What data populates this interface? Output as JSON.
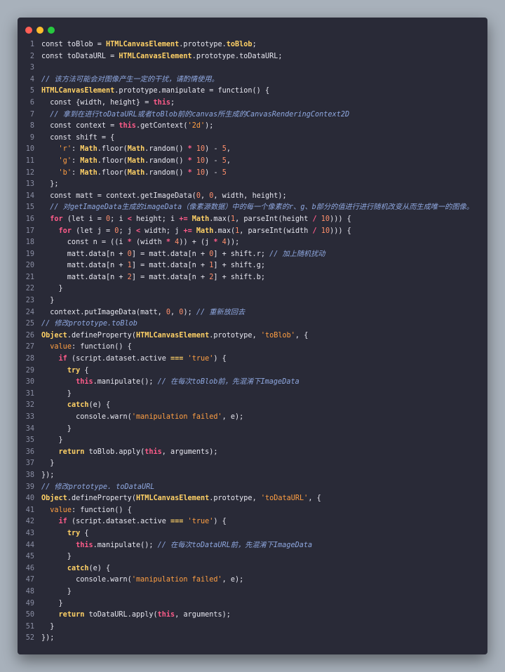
{
  "window": {
    "controls": [
      "close-dot",
      "minimize-dot",
      "maximize-dot"
    ]
  },
  "code_lines": [
    [
      {
        "t": "const toBlob = ",
        "c": "pl"
      },
      {
        "t": "HTMLCanvasElement",
        "c": "g"
      },
      {
        "t": ".prototype.",
        "c": "pl"
      },
      {
        "t": "toBlob",
        "c": "g"
      },
      {
        "t": ";",
        "c": "pl"
      }
    ],
    [
      {
        "t": "const toDataURL = ",
        "c": "pl"
      },
      {
        "t": "HTMLCanvasElement",
        "c": "g"
      },
      {
        "t": ".prototype.toDataURL;",
        "c": "pl"
      }
    ],
    [],
    [
      {
        "t": "// 该方法可能会对图像产生一定的干扰，请酌情使用。",
        "c": "c"
      }
    ],
    [
      {
        "t": "HTMLCanvasElement",
        "c": "g"
      },
      {
        "t": ".prototype.manipulate = function() {",
        "c": "pl"
      }
    ],
    [
      {
        "t": "  const {width, height} = ",
        "c": "pl"
      },
      {
        "t": "this",
        "c": "k"
      },
      {
        "t": ";",
        "c": "pl"
      }
    ],
    [
      {
        "t": "  // 拿到在进行toDataURL或者toBlob前的canvas所生成的CanvasRenderingContext2D",
        "c": "c"
      }
    ],
    [
      {
        "t": "  const context = ",
        "c": "pl"
      },
      {
        "t": "this",
        "c": "k"
      },
      {
        "t": ".getContext(",
        "c": "pl"
      },
      {
        "t": "'2d'",
        "c": "s"
      },
      {
        "t": ");",
        "c": "pl"
      }
    ],
    [
      {
        "t": "  const shift = {",
        "c": "pl"
      }
    ],
    [
      {
        "t": "    ",
        "c": "pl"
      },
      {
        "t": "'r'",
        "c": "s"
      },
      {
        "t": ": ",
        "c": "pl"
      },
      {
        "t": "Math",
        "c": "g"
      },
      {
        "t": ".floor(",
        "c": "pl"
      },
      {
        "t": "Math",
        "c": "g"
      },
      {
        "t": ".random() ",
        "c": "pl"
      },
      {
        "t": "*",
        "c": "k"
      },
      {
        "t": " ",
        "c": "pl"
      },
      {
        "t": "10",
        "c": "n"
      },
      {
        "t": ") - ",
        "c": "pl"
      },
      {
        "t": "5",
        "c": "n"
      },
      {
        "t": ",",
        "c": "pl"
      }
    ],
    [
      {
        "t": "    ",
        "c": "pl"
      },
      {
        "t": "'g'",
        "c": "s"
      },
      {
        "t": ": ",
        "c": "pl"
      },
      {
        "t": "Math",
        "c": "g"
      },
      {
        "t": ".floor(",
        "c": "pl"
      },
      {
        "t": "Math",
        "c": "g"
      },
      {
        "t": ".random() ",
        "c": "pl"
      },
      {
        "t": "*",
        "c": "k"
      },
      {
        "t": " ",
        "c": "pl"
      },
      {
        "t": "10",
        "c": "n"
      },
      {
        "t": ") - ",
        "c": "pl"
      },
      {
        "t": "5",
        "c": "n"
      },
      {
        "t": ",",
        "c": "pl"
      }
    ],
    [
      {
        "t": "    ",
        "c": "pl"
      },
      {
        "t": "'b'",
        "c": "s"
      },
      {
        "t": ": ",
        "c": "pl"
      },
      {
        "t": "Math",
        "c": "g"
      },
      {
        "t": ".floor(",
        "c": "pl"
      },
      {
        "t": "Math",
        "c": "g"
      },
      {
        "t": ".random() ",
        "c": "pl"
      },
      {
        "t": "*",
        "c": "k"
      },
      {
        "t": " ",
        "c": "pl"
      },
      {
        "t": "10",
        "c": "n"
      },
      {
        "t": ") - ",
        "c": "pl"
      },
      {
        "t": "5",
        "c": "n"
      }
    ],
    [
      {
        "t": "  };",
        "c": "pl"
      }
    ],
    [
      {
        "t": "  const matt = context.getImageData(",
        "c": "pl"
      },
      {
        "t": "0",
        "c": "n"
      },
      {
        "t": ", ",
        "c": "pl"
      },
      {
        "t": "0",
        "c": "n"
      },
      {
        "t": ", width, height);",
        "c": "pl"
      }
    ],
    [
      {
        "t": "  // 对getImageData生成的imageData（像素源数据）中的每一个像素的r、g、b部分的值进行进行随机改变从而生成唯一的图像。",
        "c": "c"
      }
    ],
    [
      {
        "t": "  ",
        "c": "pl"
      },
      {
        "t": "for",
        "c": "k"
      },
      {
        "t": " (let i = ",
        "c": "pl"
      },
      {
        "t": "0",
        "c": "n"
      },
      {
        "t": "; i ",
        "c": "pl"
      },
      {
        "t": "<",
        "c": "k"
      },
      {
        "t": " height; i ",
        "c": "pl"
      },
      {
        "t": "+=",
        "c": "k"
      },
      {
        "t": " ",
        "c": "pl"
      },
      {
        "t": "Math",
        "c": "g"
      },
      {
        "t": ".max(",
        "c": "pl"
      },
      {
        "t": "1",
        "c": "n"
      },
      {
        "t": ", parseInt(height ",
        "c": "pl"
      },
      {
        "t": "/",
        "c": "k"
      },
      {
        "t": " ",
        "c": "pl"
      },
      {
        "t": "10",
        "c": "n"
      },
      {
        "t": "))) {",
        "c": "pl"
      }
    ],
    [
      {
        "t": "    ",
        "c": "pl"
      },
      {
        "t": "for",
        "c": "k"
      },
      {
        "t": " (let j = ",
        "c": "pl"
      },
      {
        "t": "0",
        "c": "n"
      },
      {
        "t": "; j ",
        "c": "pl"
      },
      {
        "t": "<",
        "c": "k"
      },
      {
        "t": " width; j ",
        "c": "pl"
      },
      {
        "t": "+=",
        "c": "k"
      },
      {
        "t": " ",
        "c": "pl"
      },
      {
        "t": "Math",
        "c": "g"
      },
      {
        "t": ".max(",
        "c": "pl"
      },
      {
        "t": "1",
        "c": "n"
      },
      {
        "t": ", parseInt(width ",
        "c": "pl"
      },
      {
        "t": "/",
        "c": "k"
      },
      {
        "t": " ",
        "c": "pl"
      },
      {
        "t": "10",
        "c": "n"
      },
      {
        "t": "))) {",
        "c": "pl"
      }
    ],
    [
      {
        "t": "      const n = ((i ",
        "c": "pl"
      },
      {
        "t": "*",
        "c": "k"
      },
      {
        "t": " (width ",
        "c": "pl"
      },
      {
        "t": "*",
        "c": "k"
      },
      {
        "t": " ",
        "c": "pl"
      },
      {
        "t": "4",
        "c": "n"
      },
      {
        "t": ")) + (j ",
        "c": "pl"
      },
      {
        "t": "*",
        "c": "k"
      },
      {
        "t": " ",
        "c": "pl"
      },
      {
        "t": "4",
        "c": "n"
      },
      {
        "t": "));",
        "c": "pl"
      }
    ],
    [
      {
        "t": "      matt.data[n + ",
        "c": "pl"
      },
      {
        "t": "0",
        "c": "n"
      },
      {
        "t": "] = matt.data[n + ",
        "c": "pl"
      },
      {
        "t": "0",
        "c": "n"
      },
      {
        "t": "] + shift.r; ",
        "c": "pl"
      },
      {
        "t": "// 加上随机扰动",
        "c": "c"
      }
    ],
    [
      {
        "t": "      matt.data[n + ",
        "c": "pl"
      },
      {
        "t": "1",
        "c": "n"
      },
      {
        "t": "] = matt.data[n + ",
        "c": "pl"
      },
      {
        "t": "1",
        "c": "n"
      },
      {
        "t": "] + shift.g;",
        "c": "pl"
      }
    ],
    [
      {
        "t": "      matt.data[n + ",
        "c": "pl"
      },
      {
        "t": "2",
        "c": "n"
      },
      {
        "t": "] = matt.data[n + ",
        "c": "pl"
      },
      {
        "t": "2",
        "c": "n"
      },
      {
        "t": "] + shift.b;",
        "c": "pl"
      }
    ],
    [
      {
        "t": "    }",
        "c": "pl"
      }
    ],
    [
      {
        "t": "  }",
        "c": "pl"
      }
    ],
    [
      {
        "t": "  context.putImageData(matt, ",
        "c": "pl"
      },
      {
        "t": "0",
        "c": "n"
      },
      {
        "t": ", ",
        "c": "pl"
      },
      {
        "t": "0",
        "c": "n"
      },
      {
        "t": "); ",
        "c": "pl"
      },
      {
        "t": "// 重新放回去",
        "c": "c"
      }
    ],
    [
      {
        "t": "// 修改prototype.toBlob",
        "c": "c"
      }
    ],
    [
      {
        "t": "Object",
        "c": "g"
      },
      {
        "t": ".defineProperty(",
        "c": "pl"
      },
      {
        "t": "HTMLCanvasElement",
        "c": "g"
      },
      {
        "t": ".prototype, ",
        "c": "pl"
      },
      {
        "t": "'toBlob'",
        "c": "s"
      },
      {
        "t": ", {",
        "c": "pl"
      }
    ],
    [
      {
        "t": "  ",
        "c": "pl"
      },
      {
        "t": "value",
        "c": "s"
      },
      {
        "t": ": function() {",
        "c": "pl"
      }
    ],
    [
      {
        "t": "    ",
        "c": "pl"
      },
      {
        "t": "if",
        "c": "k"
      },
      {
        "t": " (script.dataset.active ",
        "c": "pl"
      },
      {
        "t": "===",
        "c": "g"
      },
      {
        "t": " ",
        "c": "pl"
      },
      {
        "t": "'true'",
        "c": "s"
      },
      {
        "t": ") {",
        "c": "pl"
      }
    ],
    [
      {
        "t": "      ",
        "c": "pl"
      },
      {
        "t": "try",
        "c": "g"
      },
      {
        "t": " {",
        "c": "pl"
      }
    ],
    [
      {
        "t": "        ",
        "c": "pl"
      },
      {
        "t": "this",
        "c": "k"
      },
      {
        "t": ".manipulate(); ",
        "c": "pl"
      },
      {
        "t": "// 在每次toBlob前，先混淆下ImageData",
        "c": "c"
      }
    ],
    [
      {
        "t": "      }",
        "c": "pl"
      }
    ],
    [
      {
        "t": "      ",
        "c": "pl"
      },
      {
        "t": "catch",
        "c": "g"
      },
      {
        "t": "(e) {",
        "c": "pl"
      }
    ],
    [
      {
        "t": "        console.warn(",
        "c": "pl"
      },
      {
        "t": "'manipulation failed'",
        "c": "s"
      },
      {
        "t": ", e);",
        "c": "pl"
      }
    ],
    [
      {
        "t": "      }",
        "c": "pl"
      }
    ],
    [
      {
        "t": "    }",
        "c": "pl"
      }
    ],
    [
      {
        "t": "    ",
        "c": "pl"
      },
      {
        "t": "return",
        "c": "g"
      },
      {
        "t": " toBlob.apply(",
        "c": "pl"
      },
      {
        "t": "this",
        "c": "k"
      },
      {
        "t": ", arguments);",
        "c": "pl"
      }
    ],
    [
      {
        "t": "  }",
        "c": "pl"
      }
    ],
    [
      {
        "t": "});",
        "c": "pl"
      }
    ],
    [
      {
        "t": "// 修改prototype. toDataURL",
        "c": "c"
      }
    ],
    [
      {
        "t": "Object",
        "c": "g"
      },
      {
        "t": ".defineProperty(",
        "c": "pl"
      },
      {
        "t": "HTMLCanvasElement",
        "c": "g"
      },
      {
        "t": ".prototype, ",
        "c": "pl"
      },
      {
        "t": "'toDataURL'",
        "c": "s"
      },
      {
        "t": ", {",
        "c": "pl"
      }
    ],
    [
      {
        "t": "  ",
        "c": "pl"
      },
      {
        "t": "value",
        "c": "s"
      },
      {
        "t": ": function() {",
        "c": "pl"
      }
    ],
    [
      {
        "t": "    ",
        "c": "pl"
      },
      {
        "t": "if",
        "c": "k"
      },
      {
        "t": " (script.dataset.active ",
        "c": "pl"
      },
      {
        "t": "===",
        "c": "g"
      },
      {
        "t": " ",
        "c": "pl"
      },
      {
        "t": "'true'",
        "c": "s"
      },
      {
        "t": ") {",
        "c": "pl"
      }
    ],
    [
      {
        "t": "      ",
        "c": "pl"
      },
      {
        "t": "try",
        "c": "g"
      },
      {
        "t": " {",
        "c": "pl"
      }
    ],
    [
      {
        "t": "        ",
        "c": "pl"
      },
      {
        "t": "this",
        "c": "k"
      },
      {
        "t": ".manipulate(); ",
        "c": "pl"
      },
      {
        "t": "// 在每次toDataURL前，先混淆下ImageData",
        "c": "c"
      }
    ],
    [
      {
        "t": "      }",
        "c": "pl"
      }
    ],
    [
      {
        "t": "      ",
        "c": "pl"
      },
      {
        "t": "catch",
        "c": "g"
      },
      {
        "t": "(e) {",
        "c": "pl"
      }
    ],
    [
      {
        "t": "        console.warn(",
        "c": "pl"
      },
      {
        "t": "'manipulation failed'",
        "c": "s"
      },
      {
        "t": ", e);",
        "c": "pl"
      }
    ],
    [
      {
        "t": "      }",
        "c": "pl"
      }
    ],
    [
      {
        "t": "    }",
        "c": "pl"
      }
    ],
    [
      {
        "t": "    ",
        "c": "pl"
      },
      {
        "t": "return",
        "c": "g"
      },
      {
        "t": " toDataURL.apply(",
        "c": "pl"
      },
      {
        "t": "this",
        "c": "k"
      },
      {
        "t": ", arguments);",
        "c": "pl"
      }
    ],
    [
      {
        "t": "  }",
        "c": "pl"
      }
    ],
    [
      {
        "t": "});",
        "c": "pl"
      }
    ]
  ]
}
